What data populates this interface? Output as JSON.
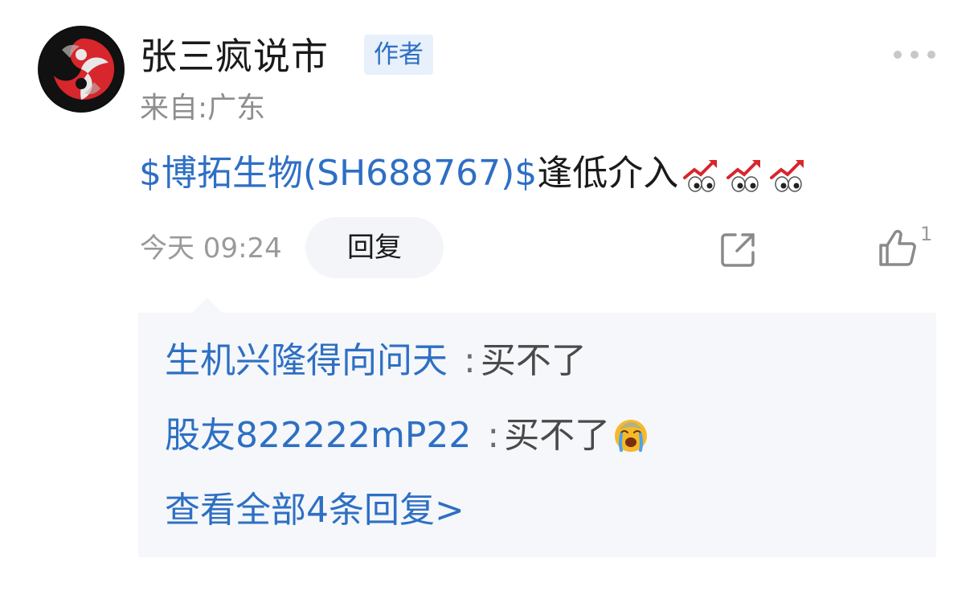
{
  "post": {
    "author_name": "张三疯说市",
    "author_badge": "作者",
    "location": "来自:广东",
    "stock_link": "$博拓生物(SH688767)$",
    "text": "逢低介入",
    "emoji_names": [
      "chart-up-eyes-emoji",
      "chart-up-eyes-emoji",
      "chart-up-eyes-emoji"
    ],
    "timestamp": "今天 09:24",
    "reply_label": "回复",
    "like_count": "1"
  },
  "replies": {
    "items": [
      {
        "user": "生机兴隆得向问天",
        "separator": ":",
        "text": "买不了"
      },
      {
        "user": "股友822222mP22",
        "separator": ":",
        "text": "买不了",
        "emoji": "crying-face-emoji"
      }
    ],
    "view_all": "查看全部4条回复>"
  },
  "colors": {
    "link": "#2e6fc4",
    "badge_bg": "#e8f0fb",
    "reply_bg": "#f5f7fa",
    "muted": "#9a9a9a"
  }
}
